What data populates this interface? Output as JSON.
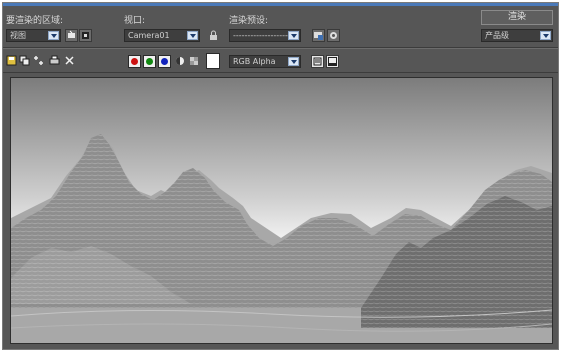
{
  "toolbar": {
    "region_label": "要渲染的区域:",
    "region_value": "视图",
    "viewport_label": "视口:",
    "viewport_value": "Camera01",
    "preset_label": "渲染预设:",
    "preset_value": "-------------------",
    "render_button": "渲染",
    "product_value": "产品级"
  },
  "channels": {
    "red_color": "#cc1111",
    "green_color": "#118811",
    "blue_color": "#1122bb",
    "display_value": "RGB Alpha"
  },
  "icons": [
    "save-image-icon",
    "copy-image-icon",
    "clone-window-icon",
    "print-icon",
    "clear-icon",
    "pin-icon",
    "preset-icon",
    "settings-icon",
    "alpha-toggle-icon",
    "mono-toggle-icon",
    "swatch-icon",
    "display-mode-icon"
  ]
}
